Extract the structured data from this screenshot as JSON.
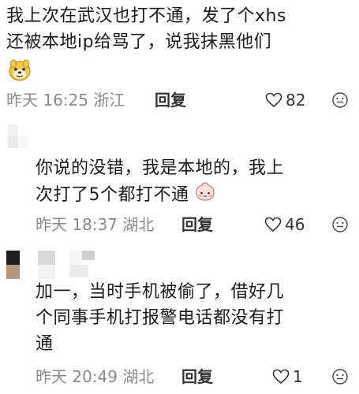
{
  "comments": [
    {
      "text_line1": "我上次在武汉也打不通，发了个xhs",
      "text_line2": "还被本地ip给骂了，说我抹黑他们",
      "emoji": "doge-face-icon",
      "date": "昨天",
      "time": "16:25",
      "location": "浙江",
      "reply_label": "回复",
      "likes": "82"
    },
    {
      "text_line1": "你说的没错，我是本地的，我上",
      "text_line2": "次打了5个都打不通",
      "emoji": "blush-face-icon",
      "date": "昨天",
      "time": "18:37",
      "location": "湖北",
      "reply_label": "回复",
      "likes": "46"
    },
    {
      "text_line1": "加一，当时手机被偷了，借好几",
      "text_line2": "个同事手机打报警电话都没有打",
      "text_line3": "通",
      "date": "昨天",
      "time": "20:49",
      "location": "湖北",
      "reply_label": "回复",
      "likes": "1"
    }
  ],
  "colors": {
    "text": "#1b1b1b",
    "meta": "#8a8a8a",
    "reply": "#333333"
  }
}
